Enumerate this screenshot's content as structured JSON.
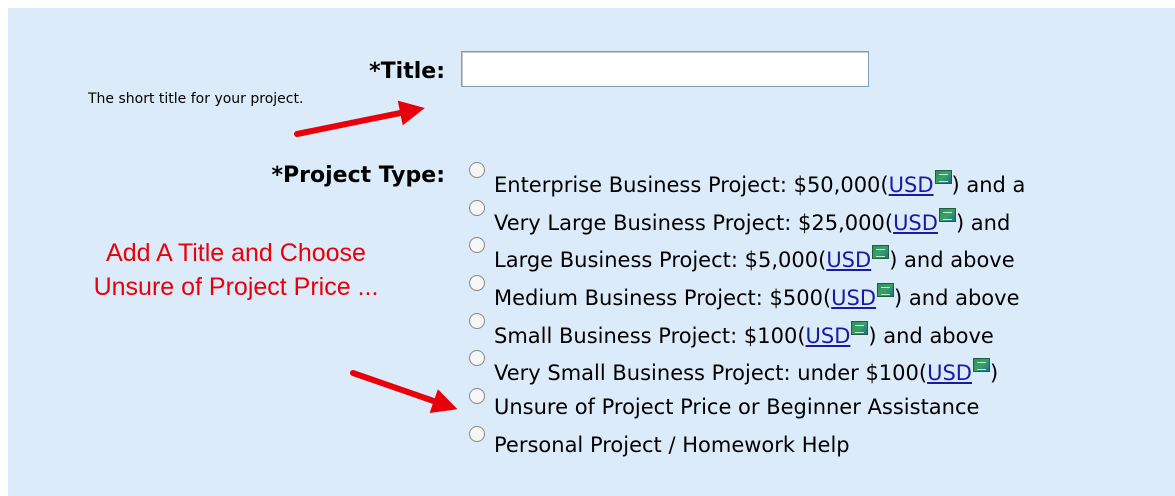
{
  "form": {
    "title_label": "*Title:",
    "title_help": "The short title for your project.",
    "title_value": "",
    "project_type_label": "*Project Type:",
    "currency_link": "USD",
    "options": [
      {
        "before": "Enterprise Business Project: $50,000(",
        "after": ") and a",
        "has_currency": true
      },
      {
        "before": "Very Large Business Project: $25,000(",
        "after": ") and",
        "has_currency": true
      },
      {
        "before": "Large Business Project: $5,000(",
        "after": ") and above",
        "has_currency": true
      },
      {
        "before": "Medium Business Project: $500(",
        "after": ") and above",
        "has_currency": true
      },
      {
        "before": "Small Business Project: $100(",
        "after": ") and above",
        "has_currency": true
      },
      {
        "before": "Very Small Business Project: under $100(",
        "after": ")",
        "has_currency": true
      },
      {
        "text": "Unsure of Project Price or Beginner Assistance",
        "has_currency": false
      },
      {
        "text": "Personal Project / Homework Help",
        "has_currency": false
      }
    ]
  },
  "annotation": {
    "line1": "Add A Title and Choose",
    "line2": "Unsure of Project Price ...",
    "color": "#e8000b"
  },
  "colors": {
    "panel_bg": "#dcebf9",
    "link": "#1a1aa6",
    "arrow": "#e8000b"
  }
}
